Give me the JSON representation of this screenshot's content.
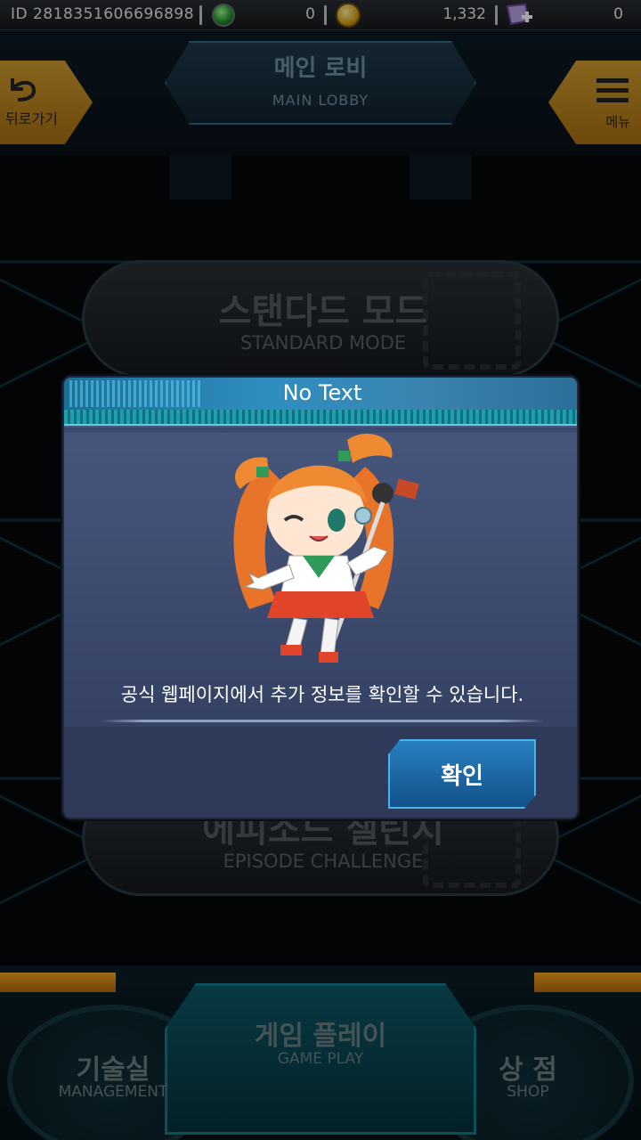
{
  "currency_bar": {
    "user_id": "ID 2818351606696898",
    "gems": "0",
    "coins": "1,332",
    "tickets": "0"
  },
  "header": {
    "title_ko": "메인 로비",
    "title_en": "MAIN LOBBY",
    "back_label": "뒤로가기",
    "menu_label": "메뉴"
  },
  "modes": [
    {
      "title_ko": "스탠다드 모드",
      "title_en": "STANDARD MODE"
    },
    {
      "title_ko": "에피소드 챌린지",
      "title_en": "EPISODE CHALLENGE"
    }
  ],
  "bottom_nav": {
    "left": {
      "ko": "기술실",
      "en": "MANAGEMENT"
    },
    "center": {
      "ko": "게임 플레이",
      "en": "GAME PLAY"
    },
    "right": {
      "ko": "상 점",
      "en": "SHOP"
    }
  },
  "dialog": {
    "title": "No Text",
    "message": "공식 웹페이지에서 추가 정보를 확인할 수 있습니다.",
    "confirm_label": "확인"
  },
  "colors": {
    "accent_orange": "#f0b330",
    "dialog_header": "#2f8ec0",
    "confirm_button": "#2a7fc0"
  }
}
